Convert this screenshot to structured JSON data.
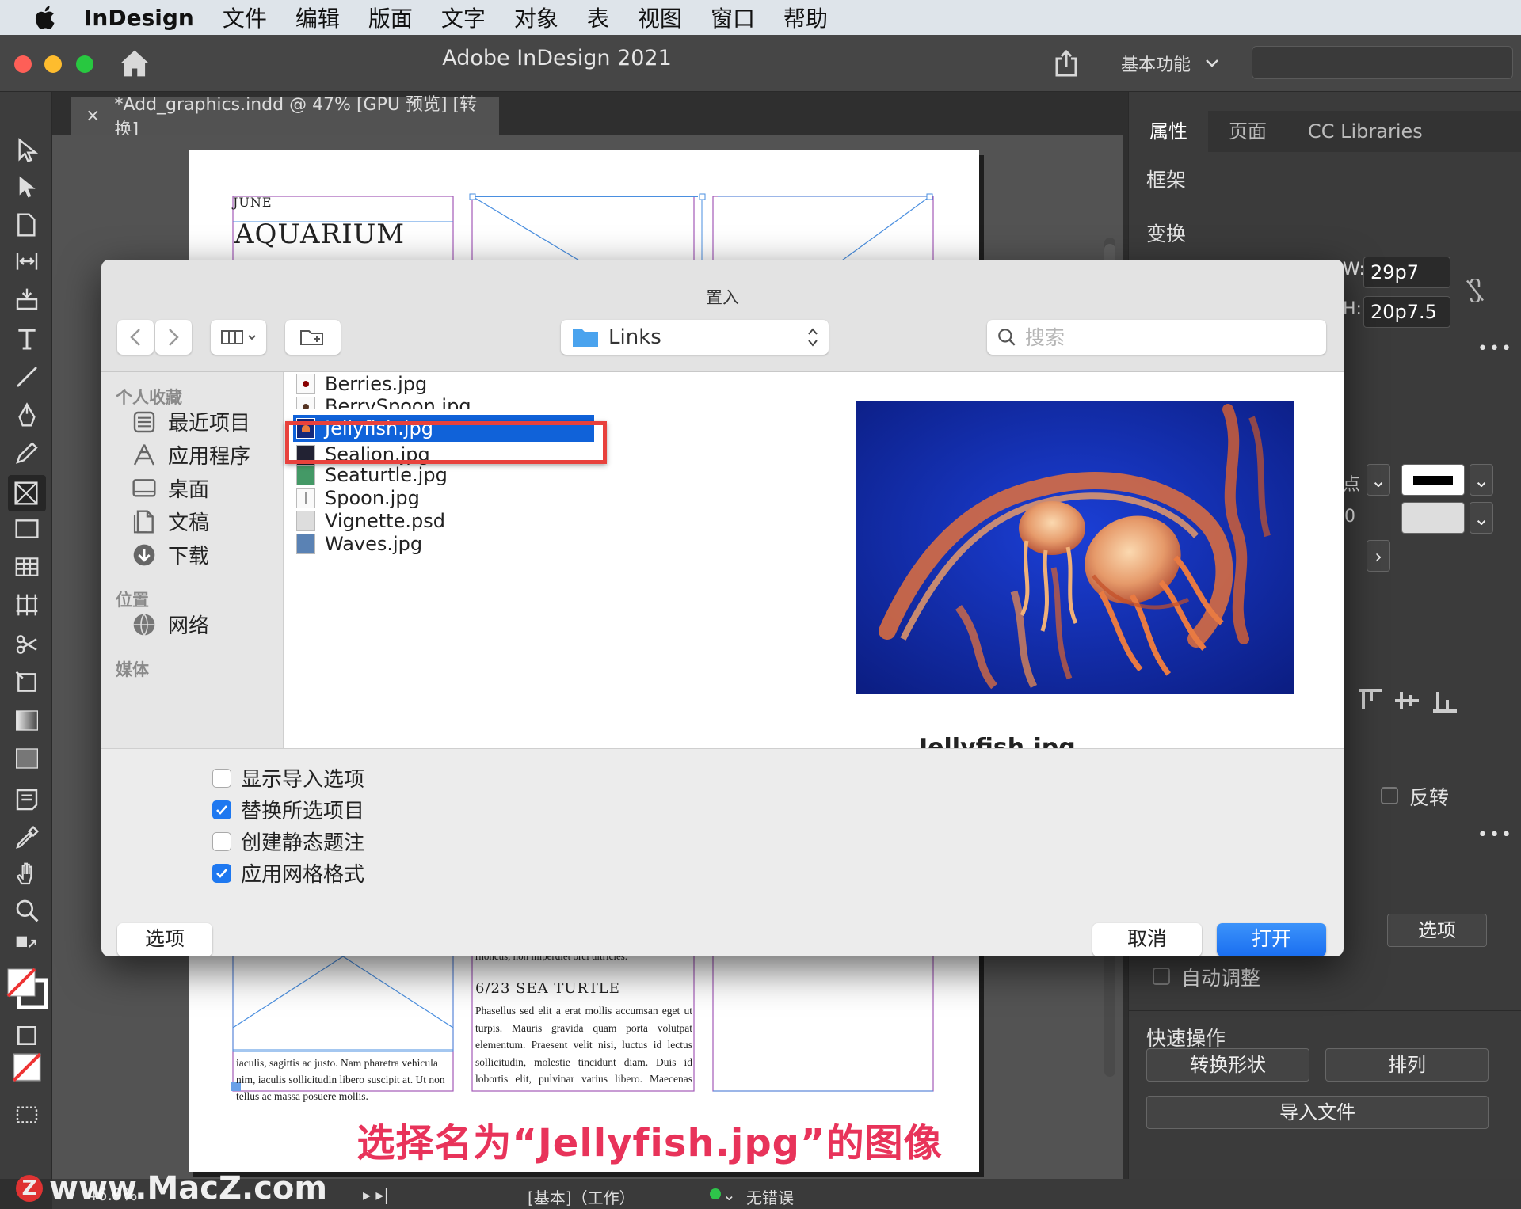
{
  "menubar": {
    "app": "InDesign",
    "items": [
      "文件",
      "编辑",
      "版面",
      "文字",
      "对象",
      "表",
      "视图",
      "窗口",
      "帮助"
    ]
  },
  "titlebar": {
    "title": "Adobe InDesign 2021",
    "workspace": "基本功能"
  },
  "doc_tab": {
    "close": "×",
    "title": "*Add_graphics.indd @ 47% [GPU 预览] [转换]"
  },
  "page": {
    "month": "JUNE",
    "heading": "AQUARIUM",
    "partial_line": "rhoncus, non imperdiet orci ultricies.",
    "event_title": "6/23 SEA TURTLE",
    "event_body": "Phasellus sed elit a erat mollis accumsan eget ut turpis. Mauris gravida quam porta volutpat elementum. Praesent velit nisi, luctus id lectus sollicitudin, molestie tincidunt diam. Duis id lobortis elit, pulvinar varius libero. Maecenas molestie nisi at tempus vestibulum. Cras ut odio at metus pulvinar laoreet. Etiam",
    "left_body": "iaculis, sagittis ac justo. Nam pharetra vehicula nim, iaculis sollicitudin libero suscipit at. Ut non tellus ac massa posuere mollis."
  },
  "panel": {
    "tabs": [
      "属性",
      "页面",
      "CC Libraries"
    ],
    "frame_label": "框架",
    "transform_label": "变换",
    "w_label": "W:",
    "w_value": "29p7",
    "h_label": "H:",
    "h_value": "20p7.5",
    "more": "•••",
    "stroke_partial": "点",
    "stroke_value": "0",
    "flip_label": "反转",
    "options_button": "选项",
    "auto_fit": "自动调整",
    "quick_actions": "快速操作",
    "convert_shape": "转换形状",
    "arrange": "排列",
    "import_file": "导入文件"
  },
  "status": {
    "zoom": "46.9%",
    "style": "[基本]（工作）",
    "errors": "无错误"
  },
  "dialog": {
    "title": "置入",
    "path": "Links",
    "search_placeholder": "搜索",
    "sidebar": {
      "favorites_head": "个人收藏",
      "favorites": [
        {
          "label": "最近项目",
          "icon": "recents-icon"
        },
        {
          "label": "应用程序",
          "icon": "applications-icon"
        },
        {
          "label": "桌面",
          "icon": "desktop-icon"
        },
        {
          "label": "文稿",
          "icon": "documents-icon"
        },
        {
          "label": "下载",
          "icon": "downloads-icon"
        }
      ],
      "locations_head": "位置",
      "locations": [
        {
          "label": "网络",
          "icon": "network-icon"
        }
      ],
      "media_head": "媒体"
    },
    "files": [
      "Berries.jpg",
      "BerrySpoon.jpg",
      "Jellyfish.jpg",
      "Sealion.jpg",
      "Seaturtle.jpg",
      "Spoon.jpg",
      "Vignette.psd",
      "Waves.jpg"
    ],
    "selected_file": "Jellyfish.jpg",
    "preview_name": "Jellyfish.jpg",
    "options": [
      {
        "label": "显示导入选项",
        "checked": false
      },
      {
        "label": "替换所选项目",
        "checked": true
      },
      {
        "label": "创建静态题注",
        "checked": false
      },
      {
        "label": "应用网格格式",
        "checked": true
      }
    ],
    "options_button": "选项",
    "cancel_button": "取消",
    "open_button": "打开"
  },
  "caption": "选择名为“Jellyfish.jpg”的图像",
  "watermark": {
    "badge": "Z",
    "text": "www.MacZ.com"
  },
  "colors": {
    "accent": "#1e78f0",
    "selection": "#1062d9",
    "highlight": "#e8413c",
    "caption": "#e8335a"
  }
}
